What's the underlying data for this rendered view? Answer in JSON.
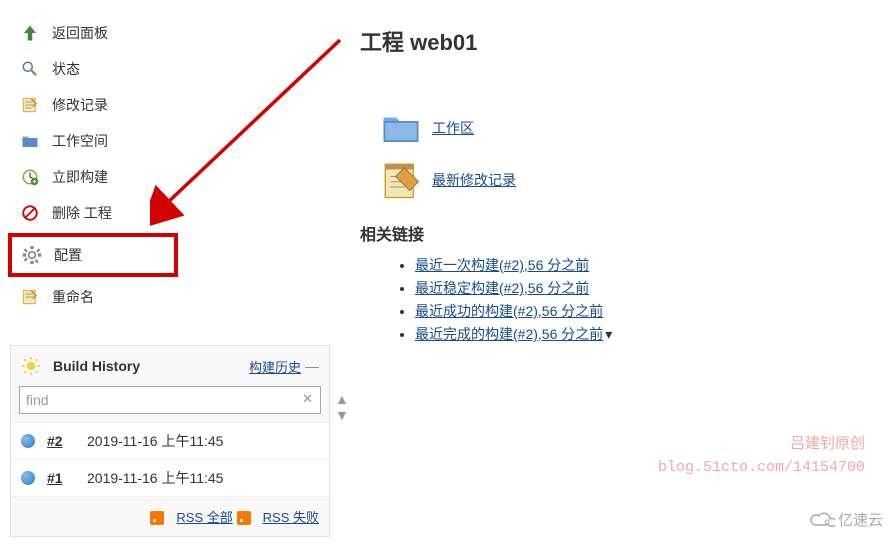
{
  "sidebar": {
    "items": [
      {
        "label": "返回面板",
        "icon": "up-arrow-icon"
      },
      {
        "label": "状态",
        "icon": "magnifier-icon"
      },
      {
        "label": "修改记录",
        "icon": "notepad-icon"
      },
      {
        "label": "工作空间",
        "icon": "folder-icon"
      },
      {
        "label": "立即构建",
        "icon": "clock-icon"
      },
      {
        "label": "删除 工程",
        "icon": "forbidden-icon"
      },
      {
        "label": "配置",
        "icon": "gear-icon"
      },
      {
        "label": "重命名",
        "icon": "rename-icon"
      }
    ]
  },
  "main": {
    "title": "工程 web01",
    "workspace_label": "工作区",
    "recent_changes_label": "最新修改记录",
    "related_heading": "相关链接",
    "related": [
      "最近一次构建(#2),56 分之前",
      "最近稳定构建(#2),56 分之前",
      "最近成功的构建(#2),56 分之前",
      "最近完成的构建(#2),56 分之前"
    ]
  },
  "history": {
    "title": "Build History",
    "trend": "构建历史",
    "search_value": "find",
    "builds": [
      {
        "num": "#2",
        "date": "2019-11-16 上午11:45"
      },
      {
        "num": "#1",
        "date": "2019-11-16 上午11:45"
      }
    ],
    "rss_all": "RSS 全部",
    "rss_fail": "RSS 失败"
  },
  "watermark": {
    "line1": "吕建钊原创",
    "line2": "blog.51cto.com/14154700"
  },
  "cloud": "亿速云"
}
